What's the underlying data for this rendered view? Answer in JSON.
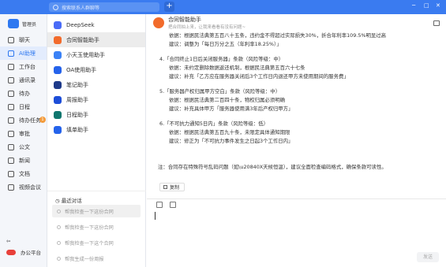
{
  "topbar": {
    "search_placeholder": "搜索联系人群聊等",
    "plus": "+",
    "win_controls": [
      "─",
      "□",
      "✕"
    ]
  },
  "user": {
    "name": "管理员"
  },
  "nav": {
    "items": [
      {
        "label": "聊天"
      },
      {
        "label": "AI助理"
      },
      {
        "label": "工作台"
      },
      {
        "label": "通讯录"
      },
      {
        "label": "待办"
      },
      {
        "label": "日程"
      },
      {
        "label": "待办任务"
      },
      {
        "label": "审批"
      },
      {
        "label": "公文"
      },
      {
        "label": "新闻"
      },
      {
        "label": "文档"
      },
      {
        "label": "视频会议"
      }
    ],
    "badge": "1",
    "bottom": {
      "back": "⇦",
      "office": "办公平台"
    }
  },
  "bots": [
    {
      "label": "DeepSeek",
      "color": "#4a6cf7"
    },
    {
      "label": "合同智能助手",
      "color": "#f26b2b"
    },
    {
      "label": "小天玉使用助手",
      "color": "#3b82f6"
    },
    {
      "label": "OA使用助手",
      "color": "#2563eb"
    },
    {
      "label": "笔记助手",
      "color": "#1e3a8a"
    },
    {
      "label": "周报助手",
      "color": "#1d4ed8"
    },
    {
      "label": "日程助手",
      "color": "#0f766e"
    },
    {
      "label": "填单助手",
      "color": "#2563eb"
    }
  ],
  "recent": {
    "title": "最近对话",
    "items": [
      "帮我检查一下这份合同",
      "帮我检查一下这份合同",
      "帮我检查一下这个合同",
      "帮我生成一份周报"
    ]
  },
  "chat": {
    "title": "合同智能助手",
    "subtitle": "把合同拍上来，让我来看看有没有问题~",
    "lines": [
      {
        "t": "依据：根据民法典第五百八十五条，违约金不得超过实际损失30%，折合年利率109.5%明显过高",
        "ind": true
      },
      {
        "t": "建议：调整为「每日万分之五（年利率18.25%）」",
        "ind": true
      },
      {
        "t": "4.「合同终止1日后关闭服务器」条款（风险等级：中）",
        "ind": false
      },
      {
        "t": "依据：未约定删除数据返还机制，根据民法典第五百六十七条",
        "ind": true
      },
      {
        "t": "建议：补充「乙方应在服务器关闭后3个工作日内退还甲方未使用期间的服务费」",
        "ind": true
      },
      {
        "t": "5.「服务器产权归属甲方空白」条款（风险等级：中）",
        "ind": false
      },
      {
        "t": "依据：根据民法典第二百四十条，物权归属必须明确",
        "ind": true
      },
      {
        "t": "建议：补充具体甲方「服务器使用满3年后产权归甲方」",
        "ind": true
      },
      {
        "t": "6.「不可抗力通知5日内」条款（风险等级：低）",
        "ind": false
      },
      {
        "t": "依据：根据民法典第五百九十条，未限定具体通知期限",
        "ind": true
      },
      {
        "t": "建议：修正为「不可抗力事件发生之日起3个工作日内」",
        "ind": true
      },
      {
        "t": "注：合同存在特殊符号乱码问题（如\\u20840X天候恒温），建议全面检查编码格式，确保条款可读性。",
        "ind": false
      }
    ],
    "copy": "复制",
    "send": "发送"
  }
}
